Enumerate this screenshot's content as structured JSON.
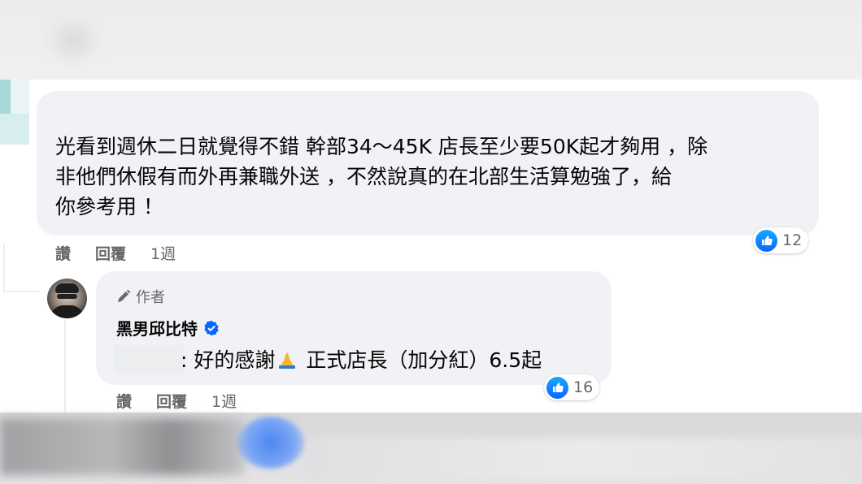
{
  "comment": {
    "text": "光看到週休二日就覺得不錯 幹部34～45K 店長至少要50K起才夠用 ，除\n非他們休假有而外再兼職外送 ，不然說真的在北部生活算勉強了，給\n你參考用 ！",
    "reaction_count": "12",
    "actions": {
      "like": "讚",
      "reply": "回覆",
      "time": "1週"
    }
  },
  "reply": {
    "author_badge": "作者",
    "name": "黑男邱比特",
    "text_before": "好的感謝",
    "emoji": "🙏",
    "text_after": " 正式店長（加分紅）6.5起",
    "reaction_count": "16",
    "actions": {
      "like": "讚",
      "reply": "回覆",
      "time": "1週"
    }
  },
  "colors": {
    "bubble_bg": "#f0f2f5",
    "meta_text": "#65676b",
    "like_blue": "#0866ff"
  },
  "icons": {
    "reaction": "like-thumb-icon",
    "author": "pencil-icon",
    "verified": "verified-badge-icon",
    "emoji": "pray-icon"
  }
}
